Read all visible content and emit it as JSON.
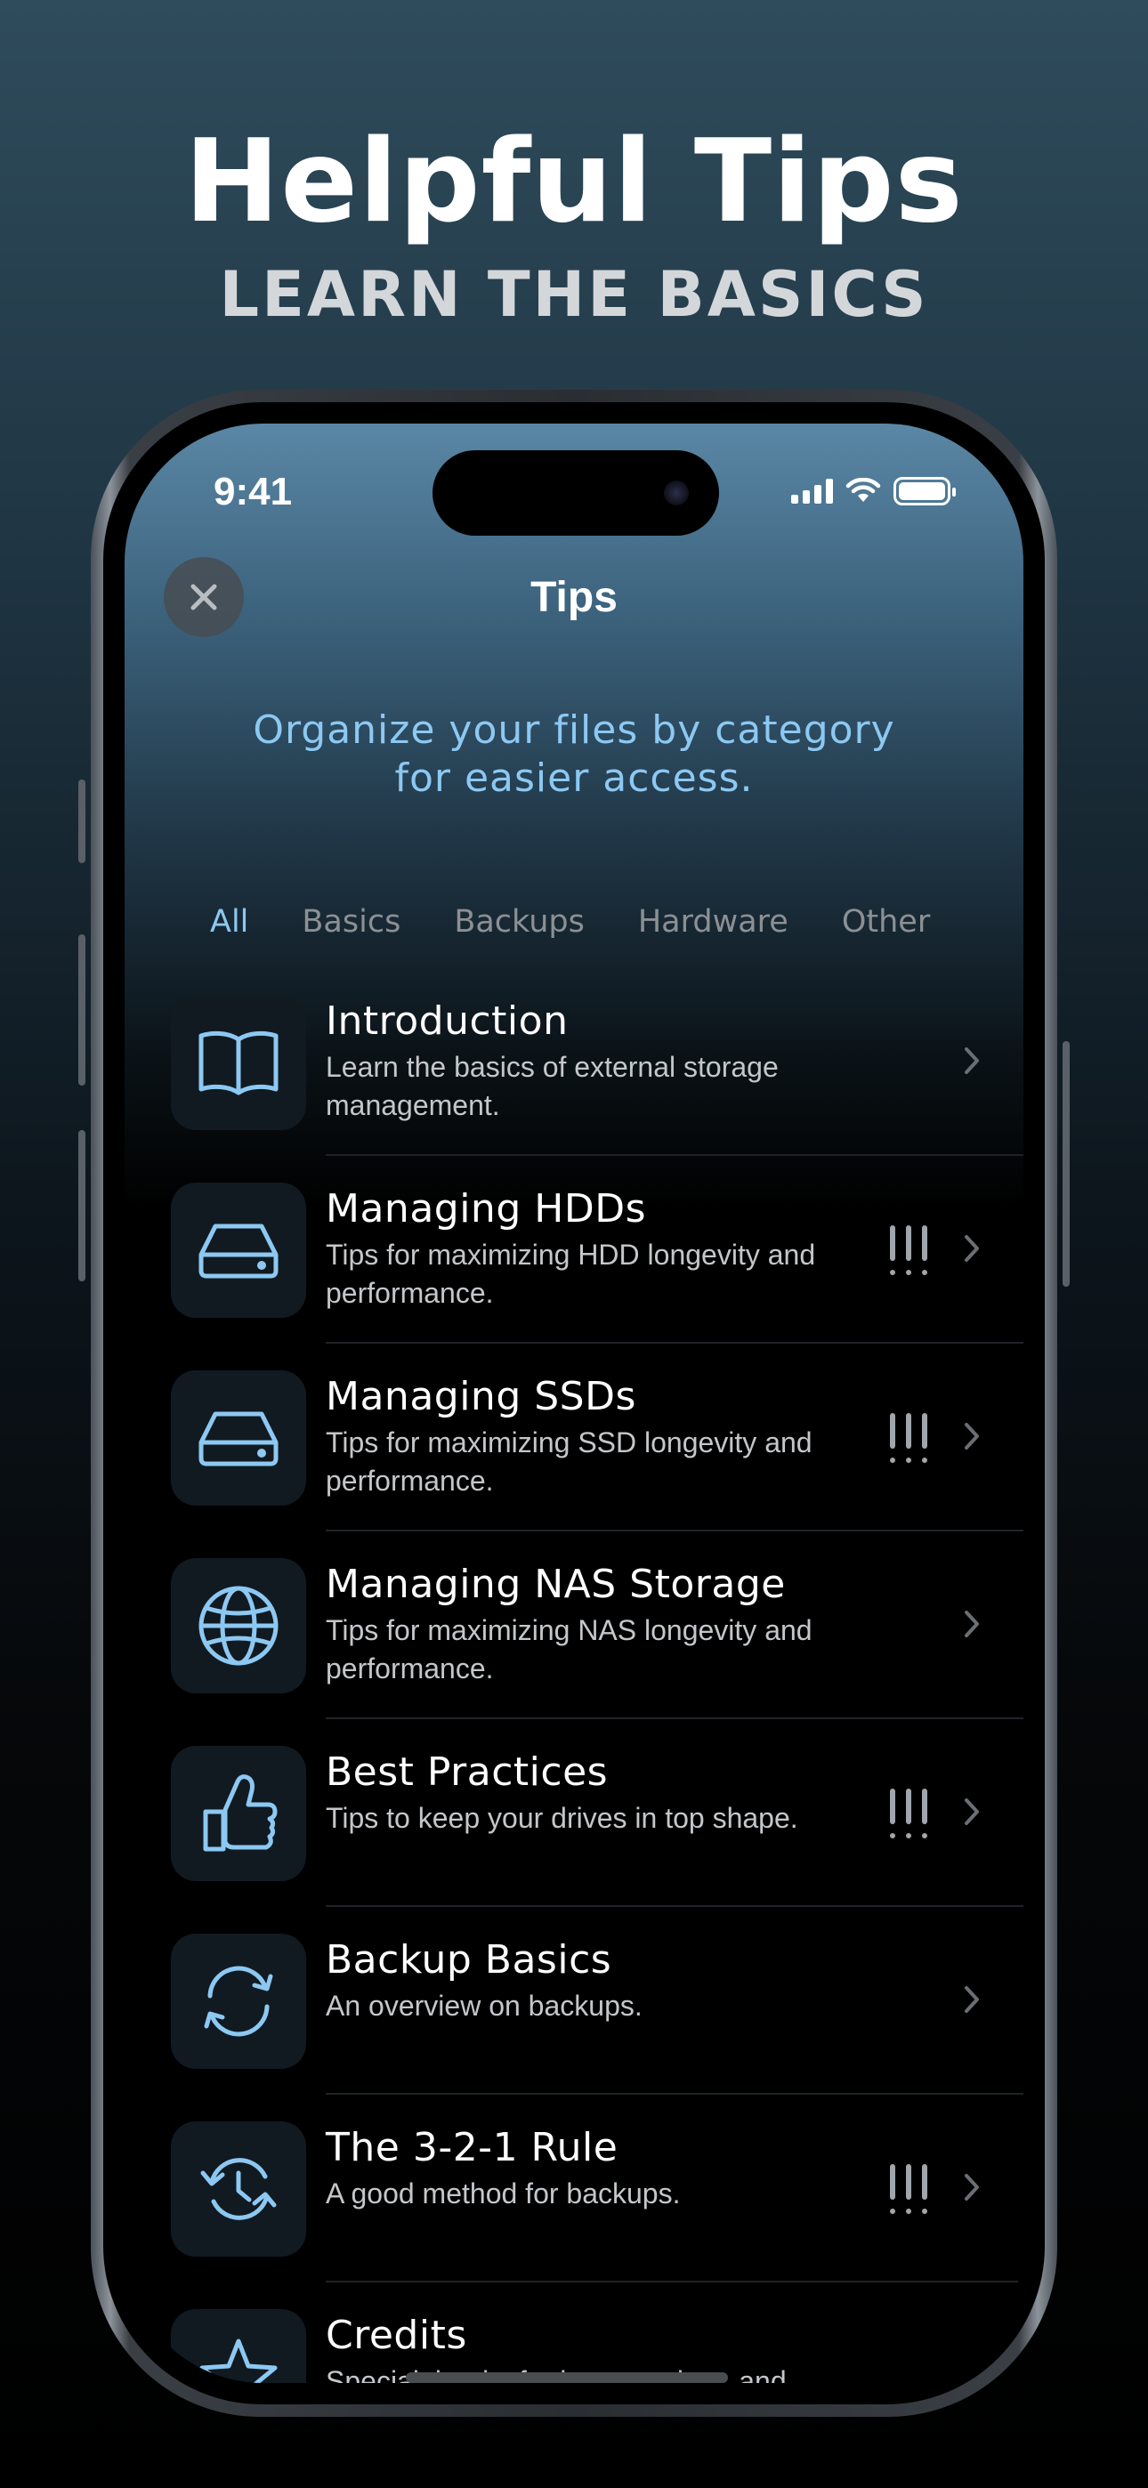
{
  "hero": {
    "title": "Helpful Tips",
    "subtitle": "LEARN THE BASICS"
  },
  "status_bar": {
    "time": "9:41"
  },
  "nav": {
    "title": "Tips",
    "close_icon": "close-icon"
  },
  "intro": {
    "line1": "Organize your files by category",
    "line2": "for easier access."
  },
  "tabs": [
    {
      "label": "All",
      "active": true
    },
    {
      "label": "Basics",
      "active": false
    },
    {
      "label": "Backups",
      "active": false
    },
    {
      "label": "Hardware",
      "active": false
    },
    {
      "label": "Other",
      "active": false
    }
  ],
  "tips": [
    {
      "icon": "book-icon",
      "title": "Introduction",
      "description": "Learn the basics of external storage management.",
      "important": false
    },
    {
      "icon": "hard-drive-icon",
      "title": "Managing HDDs",
      "description": "Tips for maximizing HDD longevity and performance.",
      "important": true
    },
    {
      "icon": "hard-drive-icon",
      "title": "Managing SSDs",
      "description": "Tips for maximizing SSD longevity and performance.",
      "important": true
    },
    {
      "icon": "globe-icon",
      "title": "Managing NAS Storage",
      "description": "Tips for maximizing NAS longevity and performance.",
      "important": false
    },
    {
      "icon": "thumbs-up-icon",
      "title": "Best Practices",
      "description": "Tips to keep your drives in top shape.",
      "important": true
    },
    {
      "icon": "sync-icon",
      "title": "Backup Basics",
      "description": "An overview on backups.",
      "important": false
    },
    {
      "icon": "history-icon",
      "title": "The 3-2-1 Rule",
      "description": "A good method for backups.",
      "important": true
    },
    {
      "icon": "star-icon",
      "title": "Credits",
      "description": "Special thanks for images, data, and",
      "important": false
    }
  ],
  "colors": {
    "accent": "#8cc8f2",
    "icon_tile": "#111a21",
    "text_secondary": "#c4c7ca"
  }
}
